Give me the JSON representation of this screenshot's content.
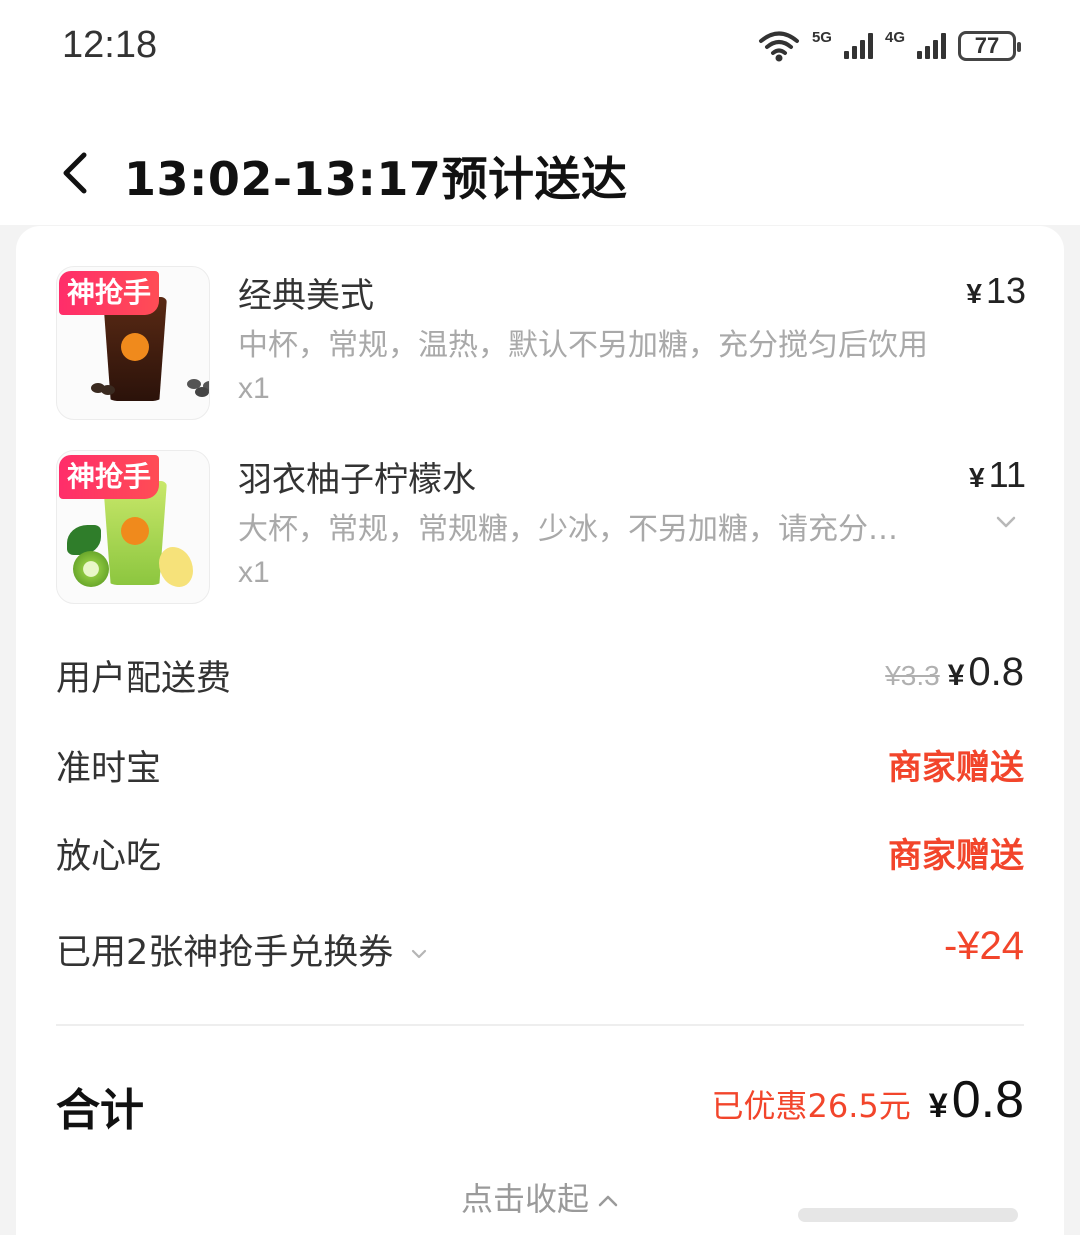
{
  "status_bar": {
    "time": "12:18",
    "network_1": "5G",
    "network_2": "4G",
    "battery": "77"
  },
  "header": {
    "title": "13:02-13:17预计送达"
  },
  "items": [
    {
      "badge": "神抢手",
      "name": "经典美式",
      "currency": "¥",
      "price": "13",
      "spec": "中杯，常规，温热，默认不另加糖，充分搅匀后饮用",
      "qty": "x1"
    },
    {
      "badge": "神抢手",
      "name": "羽衣柚子柠檬水",
      "currency": "¥",
      "price": "11",
      "spec": "大杯，常规，常规糖，少冰，不另加糖，请充分…",
      "qty": "x1"
    }
  ],
  "fees": {
    "delivery_label": "用户配送费",
    "delivery_original": "¥3.3",
    "delivery_currency": "¥",
    "delivery_price": "0.8",
    "ontime_label": "准时宝",
    "ontime_value": "商家赠送",
    "safe_label": "放心吃",
    "safe_value": "商家赠送",
    "coupon_label": "已用2张神抢手兑换券",
    "coupon_value": "-¥24"
  },
  "total": {
    "label": "合计",
    "saved": "已优惠26.5元",
    "currency": "¥",
    "price": "0.8"
  },
  "collapse_label": "点击收起",
  "colors": {
    "accent_red": "#f2452b",
    "badge_pink": "#ff2d6a"
  }
}
